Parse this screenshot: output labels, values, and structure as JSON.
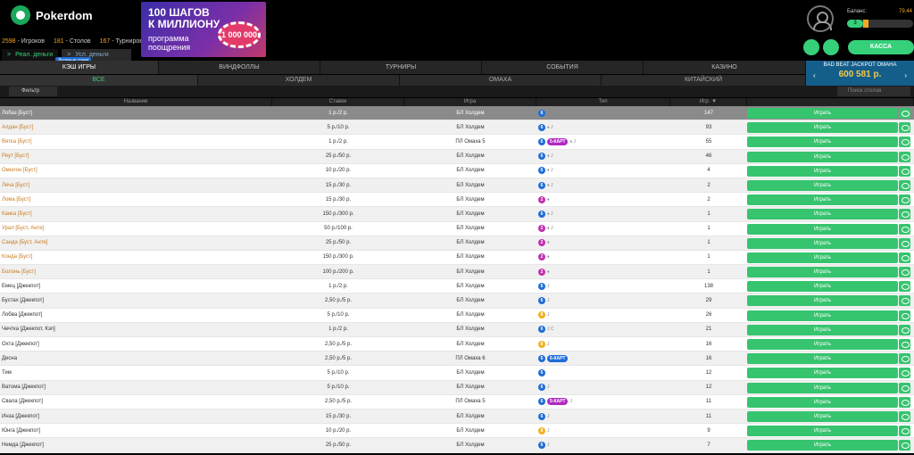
{
  "brand": {
    "name": "Pokerdom"
  },
  "stats": {
    "players_num": "2598",
    "players_label": "- Игроков",
    "tables_num": "181",
    "tables_label": "- Столов",
    "tourn_num": "167",
    "tourn_label": "- Турниров"
  },
  "money": {
    "real_arrow": ">",
    "real": "Реал. деньги",
    "cond_arrow": ">",
    "cond": "Усл. деньги",
    "speed_games": "Ледяные гонки"
  },
  "banner": {
    "line1": "100 ШАГОВ",
    "line2": "К МИЛЛИОНУ",
    "line3": "программа",
    "line4": "поощрения",
    "chip": "1 000 000"
  },
  "account": {
    "balance_label": "Баланс:",
    "balance_value": "79,44",
    "level": "3",
    "level_progress_pct": 10,
    "cashier": "КАССА"
  },
  "nav1": [
    "КЭШ ИГРЫ",
    "ВИНДФОЛЛЫ",
    "ТУРНИРЫ",
    "СОБЫТИЯ",
    "КАЗИНО"
  ],
  "nav2": [
    "ВСЕ",
    "ХОЛДЕМ",
    "ОМАХА",
    "КИТАЙСКИЙ"
  ],
  "jackpot": {
    "title": "BAD BEAT JACKPOT OMAHA",
    "value": "600 581 р.",
    "left": "‹",
    "right": "›"
  },
  "filter": {
    "label": "Фильтр",
    "search_placeholder": "Поиск столов"
  },
  "columns": {
    "name": "Название",
    "stakes": "Ставки",
    "game": "Игра",
    "type": "Тип",
    "players": "Игр.",
    "sort": "▼"
  },
  "play_label": "Играть",
  "rows": [
    {
      "name": "Лобаз [Буст]",
      "stakes": "1 р./2 р.",
      "game": "БЛ Холдем",
      "players": "147",
      "badge": "6",
      "bcolor": "blue",
      "kart": "",
      "extra": "♦ J",
      "sel": true,
      "plain": false
    },
    {
      "name": "Алдан [Буст]",
      "stakes": "5 р./10 р.",
      "game": "БЛ Холдем",
      "players": "93",
      "badge": "6",
      "bcolor": "blue",
      "kart": "",
      "extra": "♦ J",
      "sel": false,
      "plain": false
    },
    {
      "name": "Вятка [Буст]",
      "stakes": "1 р./2 р.",
      "game": "ПЛ Омаха 5",
      "players": "55",
      "badge": "6",
      "bcolor": "blue",
      "kart": "5-КАРТ",
      "extra": "♦ J",
      "sel": false,
      "plain": false
    },
    {
      "name": "Реут [Буст]",
      "stakes": "25 р./50 р.",
      "game": "БЛ Холдем",
      "players": "46",
      "badge": "6",
      "bcolor": "blue",
      "kart": "",
      "extra": "♦ J",
      "sel": false,
      "plain": false
    },
    {
      "name": "Омолон [Буст]",
      "stakes": "10 р./20 р.",
      "game": "БЛ Холдем",
      "players": "4",
      "badge": "6",
      "bcolor": "blue",
      "kart": "",
      "extra": "♦ J",
      "sel": false,
      "plain": false
    },
    {
      "name": "Леча [Буст]",
      "stakes": "15 р./30 р.",
      "game": "БЛ Холдем",
      "players": "2",
      "badge": "6",
      "bcolor": "blue",
      "kart": "",
      "extra": "♦ J",
      "sel": false,
      "plain": false
    },
    {
      "name": "Лома [Буст]",
      "stakes": "15 р./30 р.",
      "game": "БЛ Холдем",
      "players": "2",
      "badge": "2",
      "bcolor": "pink",
      "kart": "",
      "extra": "♦",
      "sel": false,
      "plain": false
    },
    {
      "name": "Канка [Буст]",
      "stakes": "150 р./300 р.",
      "game": "БЛ Холдем",
      "players": "1",
      "badge": "6",
      "bcolor": "blue",
      "kart": "",
      "extra": "♦ J",
      "sel": false,
      "plain": false
    },
    {
      "name": "Урал [Буст, Анте]",
      "stakes": "50 р./100 р.",
      "game": "БЛ Холдем",
      "players": "1",
      "badge": "2",
      "bcolor": "pink",
      "kart": "",
      "extra": "♦ J",
      "sel": false,
      "plain": false
    },
    {
      "name": "Санда [Буст, Анте]",
      "stakes": "25 р./50 р.",
      "game": "БЛ Холдем",
      "players": "1",
      "badge": "2",
      "bcolor": "pink",
      "kart": "",
      "extra": "♦",
      "sel": false,
      "plain": false
    },
    {
      "name": "Конда [Буст]",
      "stakes": "150 р./300 р.",
      "game": "БЛ Холдем",
      "players": "1",
      "badge": "2",
      "bcolor": "pink",
      "kart": "",
      "extra": "♦",
      "sel": false,
      "plain": false
    },
    {
      "name": "Болонь [Буст]",
      "stakes": "100 р./200 р.",
      "game": "БЛ Холдем",
      "players": "1",
      "badge": "2",
      "bcolor": "pink",
      "kart": "",
      "extra": "♦",
      "sel": false,
      "plain": false
    },
    {
      "name": "Емец [Джекпот]",
      "stakes": "1 р./2 р.",
      "game": "БЛ Холдем",
      "players": "138",
      "badge": "6",
      "bcolor": "blue",
      "kart": "",
      "extra": "J",
      "sel": false,
      "plain": true
    },
    {
      "name": "Бустах [Джекпот]",
      "stakes": "2,50 р./5 р.",
      "game": "БЛ Холдем",
      "players": "29",
      "badge": "6",
      "bcolor": "blue",
      "kart": "",
      "extra": "J",
      "sel": false,
      "plain": true
    },
    {
      "name": "Лобва [Джекпот]",
      "stakes": "5 р./10 р.",
      "game": "БЛ Холдем",
      "players": "26",
      "badge": "8",
      "bcolor": "yellow",
      "kart": "",
      "extra": "J",
      "sel": false,
      "plain": true
    },
    {
      "name": "Чечтка [Джекпот, Кэп]",
      "stakes": "1 р./2 р.",
      "game": "БЛ Холдем",
      "players": "21",
      "badge": "6",
      "bcolor": "blue",
      "kart": "",
      "extra": "J C",
      "sel": false,
      "plain": true
    },
    {
      "name": "Охта [Джекпот]",
      "stakes": "2,50 р./5 р.",
      "game": "БЛ Холдем",
      "players": "16",
      "badge": "8",
      "bcolor": "yellow",
      "kart": "",
      "extra": "J",
      "sel": false,
      "plain": true
    },
    {
      "name": "Десна",
      "stakes": "2,50 р./5 р.",
      "game": "ПЛ Омаха 6",
      "players": "16",
      "badge": "6",
      "bcolor": "blue",
      "kart": "6-КАРТ",
      "extra": "",
      "sel": false,
      "plain": true
    },
    {
      "name": "Тим",
      "stakes": "5 р./10 р.",
      "game": "БЛ Холдем",
      "players": "12",
      "badge": "6",
      "bcolor": "blue",
      "kart": "",
      "extra": "",
      "sel": false,
      "plain": true
    },
    {
      "name": "Ватома [Джекпот]",
      "stakes": "5 р./10 р.",
      "game": "БЛ Холдем",
      "players": "12",
      "badge": "6",
      "bcolor": "blue",
      "kart": "",
      "extra": "J",
      "sel": false,
      "plain": true
    },
    {
      "name": "Свала [Джекпот]",
      "stakes": "2,50 р./5 р.",
      "game": "ПЛ Омаха 5",
      "players": "11",
      "badge": "6",
      "bcolor": "blue",
      "kart": "5-КАРТ",
      "extra": "J",
      "sel": false,
      "plain": true
    },
    {
      "name": "Инза [Джекпот]",
      "stakes": "15 р./30 р.",
      "game": "БЛ Холдем",
      "players": "11",
      "badge": "6",
      "bcolor": "blue",
      "kart": "",
      "extra": "J",
      "sel": false,
      "plain": true
    },
    {
      "name": "Юнга [Джекпот]",
      "stakes": "10 р./20 р.",
      "game": "БЛ Холдем",
      "players": "9",
      "badge": "8",
      "bcolor": "yellow",
      "kart": "",
      "extra": "J",
      "sel": false,
      "plain": true
    },
    {
      "name": "Немда [Джекпот]",
      "stakes": "25 р./50 р.",
      "game": "БЛ Холдем",
      "players": "7",
      "badge": "6",
      "bcolor": "blue",
      "kart": "",
      "extra": "J",
      "sel": false,
      "plain": true
    }
  ]
}
